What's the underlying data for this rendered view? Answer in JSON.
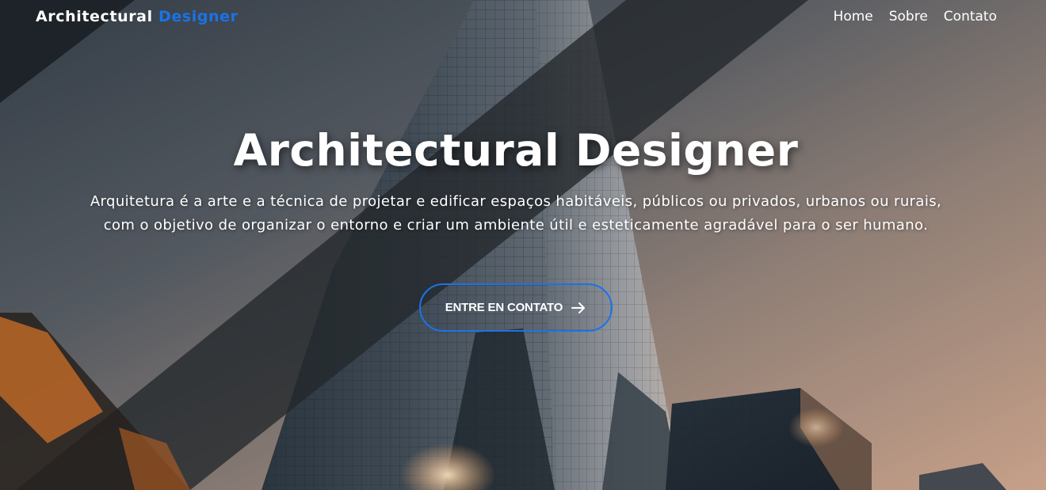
{
  "nav": {
    "brand_main": "Architectural",
    "brand_accent": "Designer",
    "links": [
      "Home",
      "Sobre",
      "Contato"
    ]
  },
  "hero": {
    "title": "Architectural Designer",
    "description": "Arquitetura é a arte e a técnica de projetar e edificar espaços habitáveis, públicos ou privados, urbanos ou rurais, com o objetivo de organizar o entorno e criar um ambiente útil e esteticamente agradável para o ser humano.",
    "cta_label": "ENTRE EN CONTATO",
    "cta_icon": "arrow-right-icon",
    "background_image": "skyscraper-sunset-photo"
  },
  "colors": {
    "accent": "#1a73e8",
    "text": "#ffffff"
  }
}
